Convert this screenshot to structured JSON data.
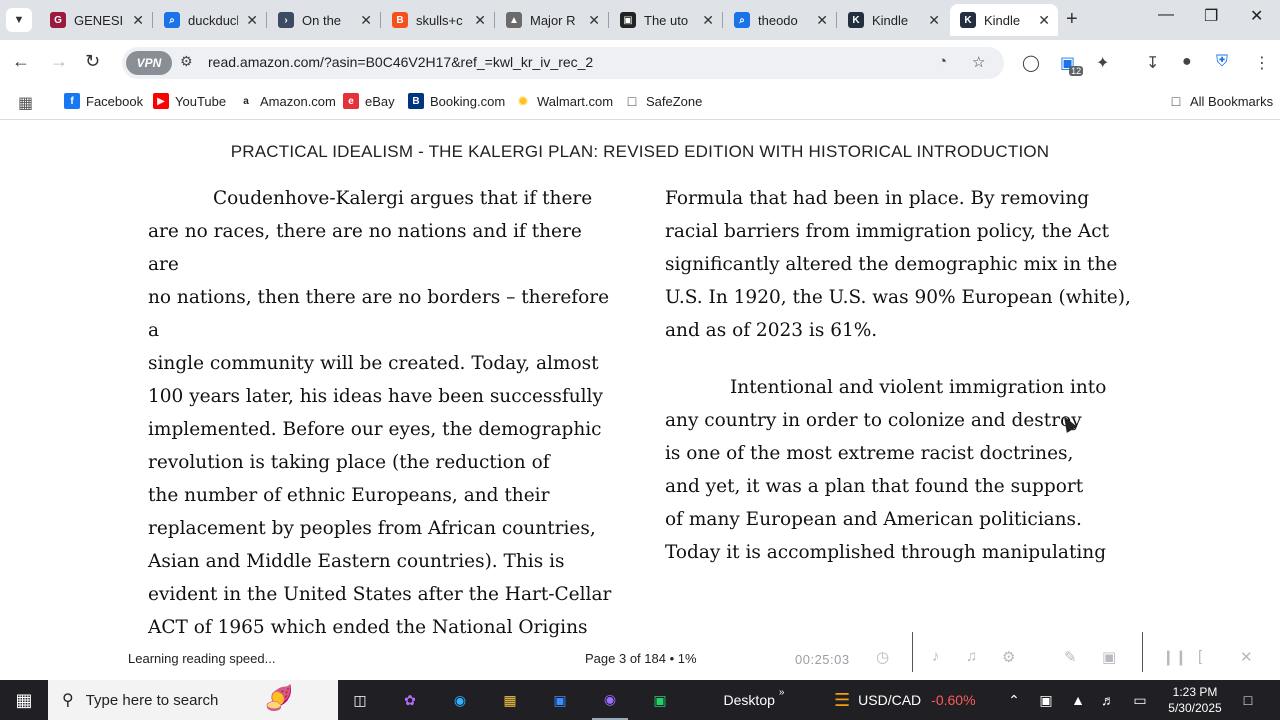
{
  "tabs": [
    {
      "title": "GENESIS",
      "color": "#9a1b3e",
      "glyph": "G"
    },
    {
      "title": "duckduck",
      "color": "#1a73e8",
      "glyph": "⌕"
    },
    {
      "title": "On the",
      "color": "#3c4a62",
      "glyph": "›"
    },
    {
      "title": "skulls+c",
      "color": "#f4511e",
      "glyph": "B"
    },
    {
      "title": "Major R",
      "color": "#6b6b6b",
      "glyph": "▲"
    },
    {
      "title": "The uto",
      "color": "#222222",
      "glyph": "▣"
    },
    {
      "title": "theodo",
      "color": "#1a73e8",
      "glyph": "⌕"
    },
    {
      "title": "Kindle",
      "color": "#232f3e",
      "glyph": "K"
    },
    {
      "title": "Kindle",
      "color": "#232f3e",
      "glyph": "K"
    }
  ],
  "toolbar": {
    "vpn_label": "VPN",
    "url": "read.amazon.com/?asin=B0C46V2H17&ref_=kwl_kr_iv_rec_2",
    "extension_badge": "12"
  },
  "bookmarks": [
    {
      "label": "Facebook",
      "color": "#1877f2",
      "glyph": "f"
    },
    {
      "label": "YouTube",
      "color": "#ff0000",
      "glyph": "▶"
    },
    {
      "label": "Amazon.com",
      "color": "#222222",
      "glyph": "a"
    },
    {
      "label": "eBay",
      "color": "#e53238",
      "glyph": "e"
    },
    {
      "label": "Booking.com",
      "color": "#003580",
      "glyph": "B"
    },
    {
      "label": "Walmart.com",
      "color": "#ffc220",
      "glyph": "✹"
    },
    {
      "label": "SafeZone",
      "color": "#ffffff",
      "glyph": "□"
    }
  ],
  "all_bookmarks": "All Bookmarks",
  "reader": {
    "book_title": "PRACTICAL IDEALISM - THE KALERGI PLAN: REVISED EDITION WITH HISTORICAL INTRODUCTION",
    "left_column": [
      "Coudenhove-Kalergi argues that if there",
      "are no races, there are no nations and if there are",
      "no nations, then there are no borders – therefore a",
      "single community will be created. Today, almost",
      "100 years later, his ideas have been successfully",
      "implemented. Before our eyes, the demographic",
      "revolution is taking place (the reduction of",
      "the number of ethnic Europeans, and their",
      "replacement by peoples from African countries,",
      "Asian and Middle Eastern countries). This is",
      "evident in the United States after the Hart-Cellar",
      "ACT of 1965 which ended the National Origins"
    ],
    "right_column_p1": [
      "Formula that had been in place. By removing",
      "racial barriers from immigration policy, the Act",
      "significantly altered the demographic mix in the",
      "U.S. In 1920, the U.S. was 90% European (white),",
      "and as of 2023 is 61%."
    ],
    "right_column_p2": [
      "Intentional and violent immigration into",
      "any country in order to colonize and destroy",
      "is one of the most extreme racist doctrines,",
      "and yet, it was a plan that found the support",
      "of many European and American politicians.",
      "Today it is accomplished through manipulating"
    ],
    "status_left": "Learning reading speed...",
    "page_info": "Page 3 of 184",
    "percent": "1%",
    "timer": "00:25:03"
  },
  "taskbar": {
    "search_placeholder": "Type here to search",
    "desktop_label": "Desktop",
    "ticker": "USD/CAD",
    "ticker_change": "-0.60%",
    "time": "1:23 PM",
    "date": "5/30/2025"
  }
}
